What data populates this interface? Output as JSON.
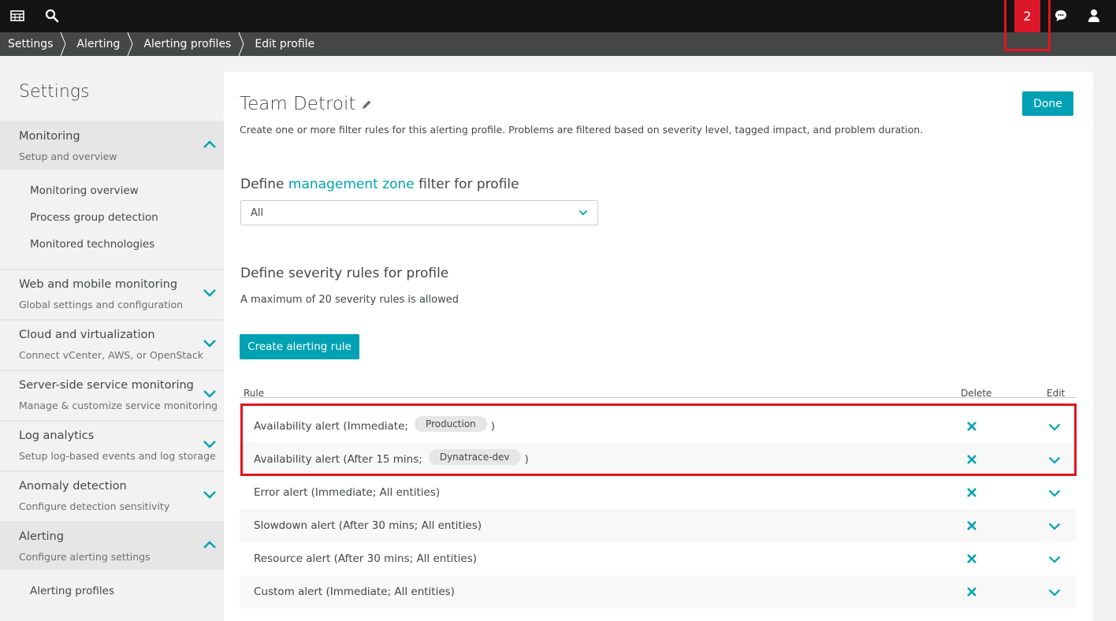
{
  "topbar": {
    "notification_count": "2",
    "icons": [
      "apps-menu-icon",
      "search-icon",
      "chat-icon",
      "user-icon"
    ]
  },
  "breadcrumb": [
    "Settings",
    "Alerting",
    "Alerting profiles",
    "Edit profile"
  ],
  "sidebar": {
    "title": "Settings",
    "sections": [
      {
        "title": "Monitoring",
        "subtitle": "Setup and overview",
        "expanded": true
      },
      {
        "title": "Web and mobile monitoring",
        "subtitle": "Global settings and configuration",
        "expanded": false
      },
      {
        "title": "Cloud and virtualization",
        "subtitle": "Connect vCenter, AWS, or OpenStack",
        "expanded": false
      },
      {
        "title": "Server-side service monitoring",
        "subtitle": "Manage & customize service monitoring",
        "expanded": false
      },
      {
        "title": "Log analytics",
        "subtitle": "Setup log-based events and log storage",
        "expanded": false
      },
      {
        "title": "Anomaly detection",
        "subtitle": "Configure detection sensitivity",
        "expanded": false
      },
      {
        "title": "Alerting",
        "subtitle": "Configure alerting settings",
        "expanded": true
      }
    ],
    "monitoring_items": [
      "Monitoring overview",
      "Process group detection",
      "Monitored technologies"
    ],
    "alerting_items": [
      "Alerting profiles"
    ]
  },
  "main": {
    "profile_name": "Team Detroit",
    "description": "Create one or more filter rules for this alerting profile. Problems are filtered based on severity level, tagged impact, and problem duration.",
    "done_label": "Done",
    "mz_heading_pre": "Define",
    "mz_heading_link": "management zone",
    "mz_heading_post": "filter for profile",
    "mz_selected": "All",
    "severity_heading": "Define severity rules for profile",
    "severity_note": "A maximum of 20 severity rules is allowed",
    "create_label": "Create alerting rule",
    "columns": {
      "rule": "Rule",
      "delete": "Delete",
      "edit": "Edit"
    },
    "rules": [
      {
        "pre": "Availability alert (Immediate;",
        "tag": "Production",
        "post": ")"
      },
      {
        "pre": "Availability alert (After 15 mins;",
        "tag": "Dynatrace-dev",
        "post": ")"
      },
      {
        "pre": "Error alert (Immediate; All entities)",
        "tag": "",
        "post": ""
      },
      {
        "pre": "Slowdown alert (After 30 mins; All entities)",
        "tag": "",
        "post": ""
      },
      {
        "pre": "Resource alert (After 30 mins; All entities)",
        "tag": "",
        "post": ""
      },
      {
        "pre": "Custom alert (Immediate; All entities)",
        "tag": "",
        "post": ""
      }
    ]
  },
  "colors": {
    "accent": "#00a1b2",
    "highlight": "#e2141d",
    "notification": "#dc172a",
    "topbar": "#141414",
    "breadcrumb": "#454646"
  }
}
